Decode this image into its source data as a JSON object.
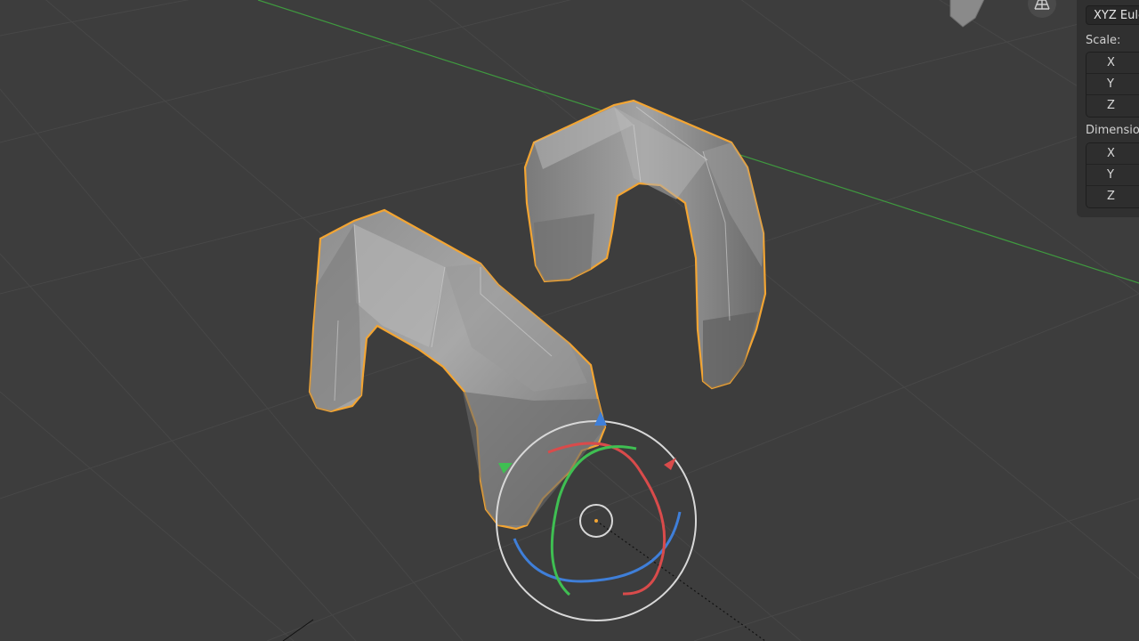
{
  "npanel": {
    "rotation_mode": "XYZ Euler",
    "scale_label": "Scale:",
    "scale_axes": [
      "X",
      "Y",
      "Z"
    ],
    "dimensions_label": "Dimensions:",
    "dimension_axes": [
      "X",
      "Y",
      "Z"
    ]
  },
  "icons": {
    "grid": "grid-icon",
    "gizmo": "rotate-gizmo-icon"
  },
  "colors": {
    "background": "#3d3d3d",
    "selection_outline": "#f3a533",
    "x_axis_green_line": "#3f9a3f",
    "gizmo_x": "#d94b4b",
    "gizmo_y": "#3fbf52",
    "gizmo_z": "#3f7fd9"
  }
}
